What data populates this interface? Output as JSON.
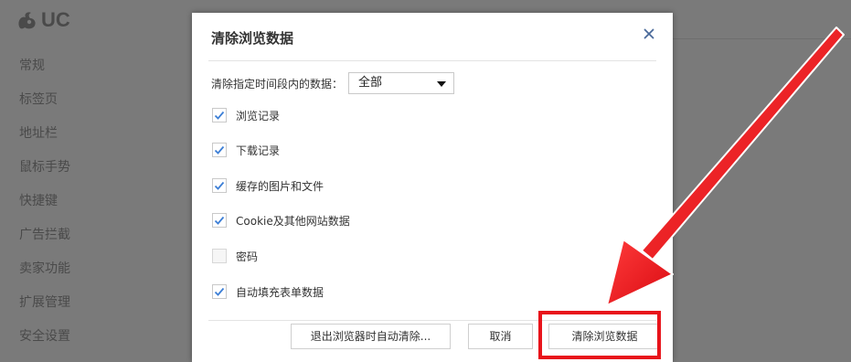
{
  "background": {
    "logo_text": "UC",
    "nav_items": [
      "常规",
      "标签页",
      "地址栏",
      "鼠标手势",
      "快捷键",
      "广告拦截",
      "卖家功能",
      "扩展管理",
      "安全设置"
    ]
  },
  "dialog": {
    "title": "清除浏览数据",
    "close_icon": "close-icon",
    "range": {
      "label": "清除指定时间段内的数据：",
      "selected": "全部"
    },
    "options": [
      {
        "label": "浏览记录",
        "checked": true
      },
      {
        "label": "下载记录",
        "checked": true
      },
      {
        "label": "缓存的图片和文件",
        "checked": true
      },
      {
        "label": "Cookie及其他网站数据",
        "checked": true
      },
      {
        "label": "密码",
        "checked": false
      },
      {
        "label": "自动填充表单数据",
        "checked": true
      }
    ],
    "buttons": {
      "auto_clear": "退出浏览器时自动清除...",
      "cancel": "取消",
      "clear": "清除浏览数据"
    }
  },
  "annotation": {
    "color": "#e8141b"
  }
}
